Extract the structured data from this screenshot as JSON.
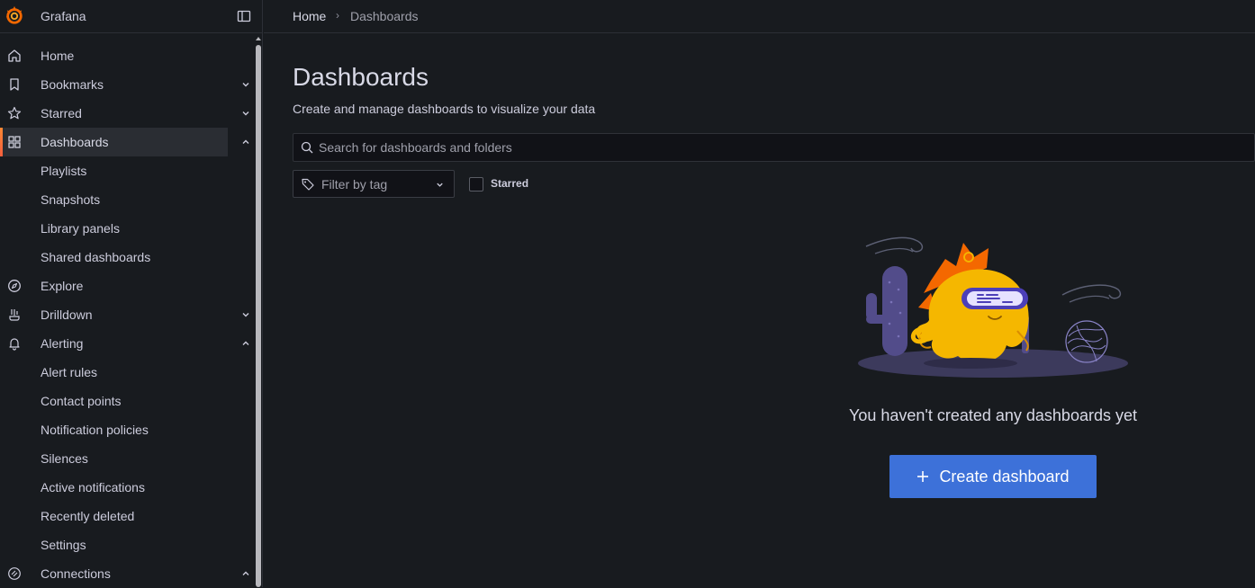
{
  "app": {
    "name": "Grafana"
  },
  "nav": {
    "home": "Home",
    "bookmarks": "Bookmarks",
    "starred": "Starred",
    "dashboards": "Dashboards",
    "dashboards_children": [
      "Playlists",
      "Snapshots",
      "Library panels",
      "Shared dashboards"
    ],
    "explore": "Explore",
    "drilldown": "Drilldown",
    "alerting": "Alerting",
    "alerting_children": [
      "Alert rules",
      "Contact points",
      "Notification policies",
      "Silences",
      "Active notifications",
      "Recently deleted",
      "Settings"
    ],
    "connections": "Connections"
  },
  "breadcrumb": {
    "home": "Home",
    "separator": "›",
    "current": "Dashboards"
  },
  "page": {
    "title": "Dashboards",
    "subtitle": "Create and manage dashboards to visualize your data"
  },
  "search": {
    "placeholder": "Search for dashboards and folders",
    "value": ""
  },
  "filter": {
    "tag_label": "Filter by tag",
    "starred_label": "Starred",
    "starred_checked": false
  },
  "empty_state": {
    "message": "You haven't created any dashboards yet",
    "button": "Create dashboard"
  },
  "colors": {
    "background": "#181b1f",
    "accent_orange": "#ff8833",
    "primary_blue": "#3d71d9",
    "text": "#ccccdc"
  },
  "icons": [
    "grafana-logo",
    "dock-icon",
    "home-icon",
    "bookmark-icon",
    "star-icon",
    "apps-icon",
    "compass-icon",
    "drilldown-icon",
    "bell-icon",
    "link-icon",
    "search-icon",
    "tag-icon",
    "plus-icon"
  ]
}
